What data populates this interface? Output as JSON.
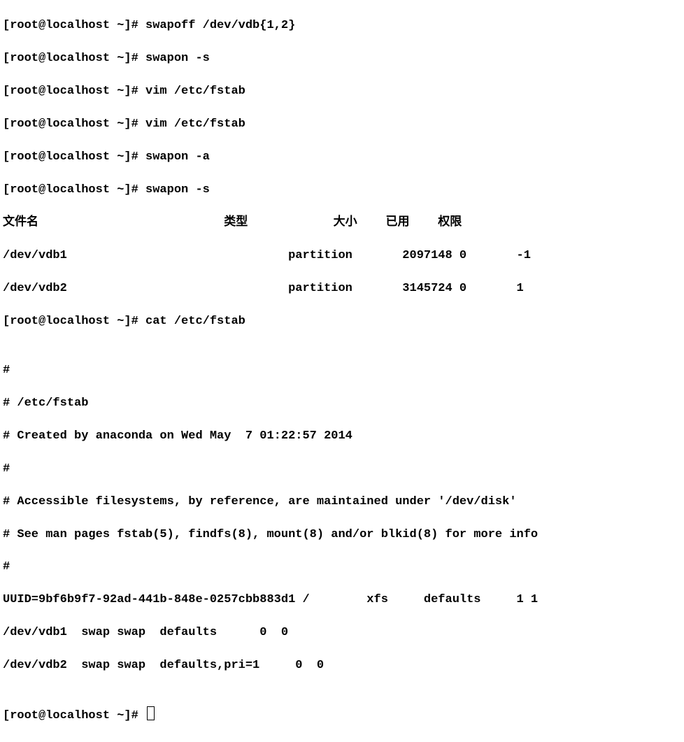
{
  "lines": {
    "l0": "[root@localhost ~]# swapoff /dev/vdb{1,2}",
    "l1": "[root@localhost ~]# swapon -s",
    "l2": "[root@localhost ~]# vim /etc/fstab",
    "l3": "[root@localhost ~]# vim /etc/fstab",
    "l4": "[root@localhost ~]# swapon -a",
    "l5": "[root@localhost ~]# swapon -s",
    "l6": "文件名                          类型            大小    已用    权限",
    "l7": "/dev/vdb1                               partition       2097148 0       -1",
    "l8": "/dev/vdb2                               partition       3145724 0       1",
    "l9": "[root@localhost ~]# cat /etc/fstab",
    "l10": "",
    "l11": "#",
    "l12": "# /etc/fstab",
    "l13": "# Created by anaconda on Wed May  7 01:22:57 2014",
    "l14": "#",
    "l15": "# Accessible filesystems, by reference, are maintained under '/dev/disk'",
    "l16": "# See man pages fstab(5), findfs(8), mount(8) and/or blkid(8) for more info",
    "l17": "#",
    "l18": "UUID=9bf6b9f7-92ad-441b-848e-0257cbb883d1 /        xfs     defaults     1 1",
    "l19": "/dev/vdb1  swap swap  defaults      0  0",
    "l20": "/dev/vdb2  swap swap  defaults,pri=1     0  0",
    "l21": "",
    "l22": "[root@localhost ~]# "
  }
}
